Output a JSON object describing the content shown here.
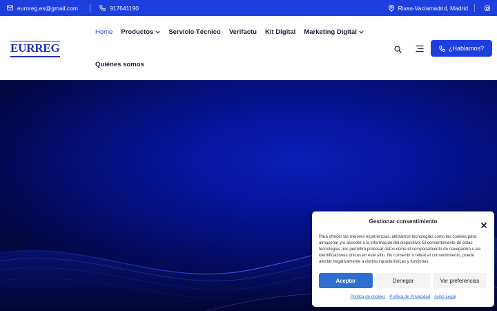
{
  "topbar": {
    "email": "euroreg.es@gmail.com",
    "phone": "917641190",
    "location": "Rivas-Vaciamadrid, Madrid",
    "email_icon": "envelope-icon",
    "phone_icon": "phone-icon",
    "location_icon": "map-pin-icon",
    "social_icon": "instagram-icon"
  },
  "header": {
    "logo_text": "EURREG",
    "nav": [
      {
        "label": "Home",
        "active": true
      },
      {
        "label": "Productos",
        "has_dropdown": true
      },
      {
        "label": "Servicio Técnico"
      },
      {
        "label": "Verifactu"
      },
      {
        "label": "Kit Digital"
      },
      {
        "label": "Marketing Digital",
        "has_dropdown": true
      },
      {
        "label": "Quiénes somos"
      }
    ],
    "cta_label": "¿Hablamos?"
  },
  "cookie": {
    "title": "Gestionar consentimiento",
    "body": "Para ofrecer las mejores experiencias, utilizamos tecnologías como las cookies para almacenar y/o acceder a la información del dispositivo. El consentimiento de estas tecnologías nos permitirá procesar datos como el comportamiento de navegación o las identificaciones únicas en este sitio. No consentir o retirar el consentimiento, puede afectar negativamente a ciertas características y funciones.",
    "accept_label": "Aceptar",
    "deny_label": "Denegar",
    "prefs_label": "Ver preferencias",
    "links": [
      "Política de cookies",
      "Política de Privacidad",
      "Aviso Legal"
    ]
  },
  "colors": {
    "brand_blue": "#1d3fe0",
    "logo_blue": "#1f2fb8",
    "accept_blue": "#2f6fd0",
    "hero_dark": "#03083f"
  }
}
